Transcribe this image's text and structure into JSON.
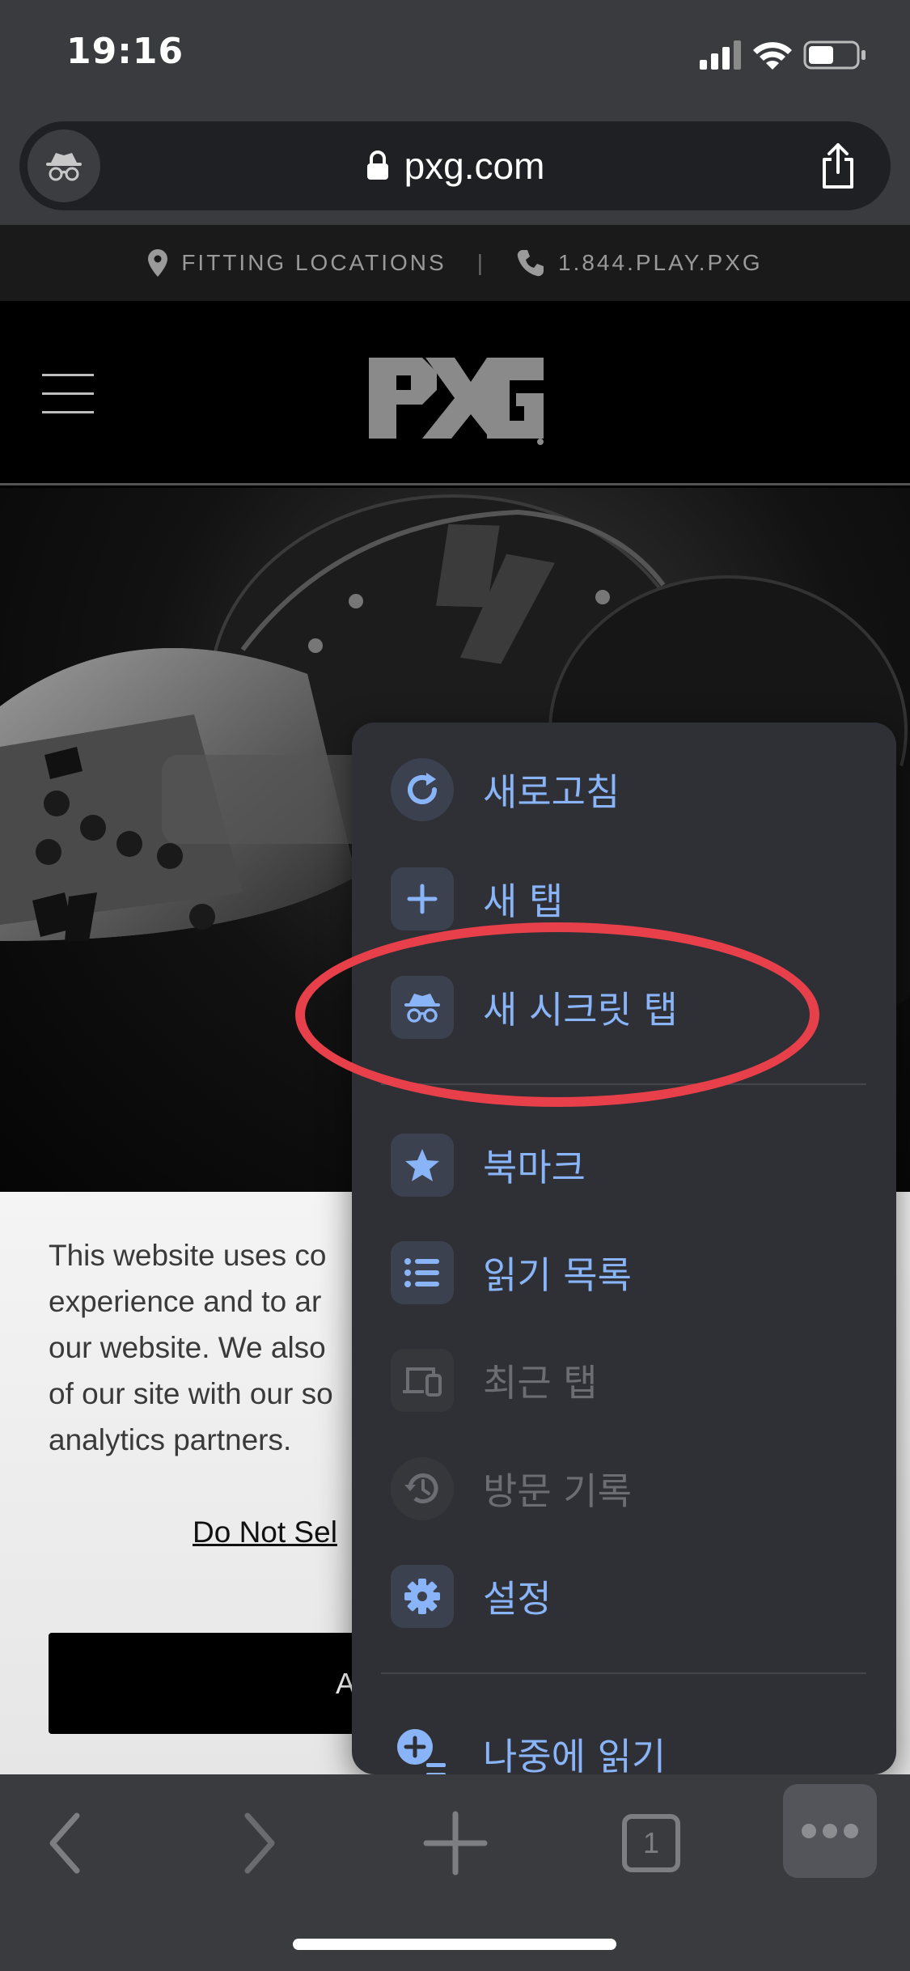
{
  "status_bar": {
    "time": "19:16"
  },
  "browser": {
    "url": "pxg.com"
  },
  "site": {
    "topbar": {
      "fitting_locations": "FITTING LOCATIONS",
      "separator": "|",
      "phone": "1.844.PLAY.PXG"
    },
    "logo_text": "PXG"
  },
  "cookie_banner": {
    "lines": [
      "This website uses co",
      "experience and to ar",
      "our website. We also",
      "of our site with our so",
      "analytics partners."
    ],
    "link": "Do Not Sel",
    "accept_label": "A"
  },
  "menu": {
    "items": [
      {
        "label": "새로고침",
        "icon": "reload-icon",
        "enabled": true
      },
      {
        "label": "새 탭",
        "icon": "plus-icon",
        "enabled": true
      },
      {
        "label": "새 시크릿 탭",
        "icon": "incognito-icon",
        "enabled": true
      },
      {
        "label": "북마크",
        "icon": "star-icon",
        "enabled": true
      },
      {
        "label": "읽기 목록",
        "icon": "list-icon",
        "enabled": true
      },
      {
        "label": "최근 탭",
        "icon": "devices-icon",
        "enabled": false
      },
      {
        "label": "방문 기록",
        "icon": "history-icon",
        "enabled": false
      },
      {
        "label": "설정",
        "icon": "gear-icon",
        "enabled": true
      },
      {
        "label": "나중에 읽기",
        "icon": "read-later-icon",
        "enabled": true
      }
    ]
  },
  "toolbar": {
    "tab_count": "1"
  },
  "colors": {
    "accent": "#8ab4f8",
    "highlight": "#e8404a",
    "menu_bg": "#2f3035"
  }
}
